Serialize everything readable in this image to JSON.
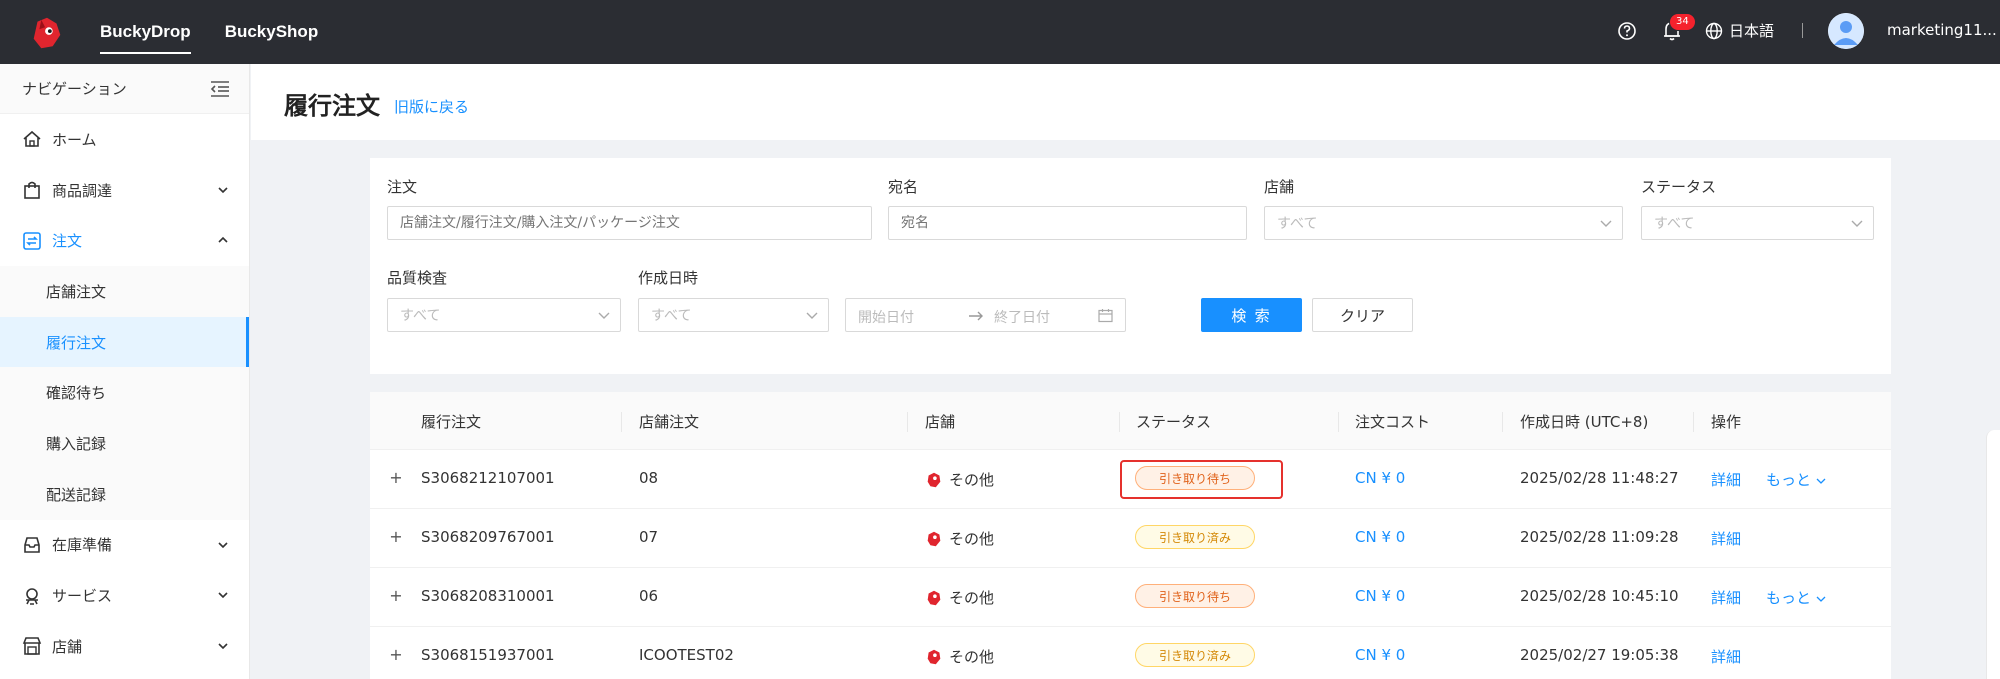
{
  "header": {
    "nav": [
      "BuckyDrop",
      "BuckyShop"
    ],
    "active_nav": "BuckyDrop",
    "notification_count": "34",
    "language": "日本語",
    "username": "marketing11..."
  },
  "sidebar": {
    "title": "ナビゲーション",
    "items": [
      {
        "label": "ホーム"
      },
      {
        "label": "商品調達"
      },
      {
        "label": "注文"
      },
      {
        "label": "在庫準備"
      },
      {
        "label": "サービス"
      },
      {
        "label": "店舗"
      }
    ],
    "order_sub": [
      {
        "label": "店舗注文"
      },
      {
        "label": "履行注文"
      },
      {
        "label": "確認待ち"
      },
      {
        "label": "購入記録"
      },
      {
        "label": "配送記録"
      }
    ]
  },
  "page": {
    "title": "履行注文",
    "back_link": "旧版に戻る"
  },
  "filters": {
    "order_label": "注文",
    "order_placeholder": "店舗注文/履行注文/購入注文/パッケージ注文",
    "recipient_label": "宛名",
    "recipient_placeholder": "宛名",
    "shop_label": "店舗",
    "shop_value": "すべて",
    "status_label": "ステータス",
    "status_value": "すべて",
    "qc_label": "品質検査",
    "qc_value": "すべて",
    "created_label": "作成日時",
    "created_value": "すべて",
    "start_date": "開始日付",
    "end_date": "終了日付",
    "search_btn": "検 索",
    "clear_btn": "クリア"
  },
  "table": {
    "columns": [
      "履行注文",
      "店舗注文",
      "店舗",
      "ステータス",
      "注文コスト",
      "作成日時 (UTC+8)",
      "操作"
    ],
    "rows": [
      {
        "id": "S3068212107001",
        "shop_order": "08",
        "shop": "その他",
        "status": "引き取り待ち",
        "status_type": "wait",
        "cost": "CN ¥ 0",
        "created": "2025/02/28 11:48:27",
        "detail": "詳細",
        "more": "もっと"
      },
      {
        "id": "S3068209767001",
        "shop_order": "07",
        "shop": "その他",
        "status": "引き取り済み",
        "status_type": "done",
        "cost": "CN ¥ 0",
        "created": "2025/02/28 11:09:28",
        "detail": "詳細",
        "more": ""
      },
      {
        "id": "S3068208310001",
        "shop_order": "06",
        "shop": "その他",
        "status": "引き取り待ち",
        "status_type": "wait",
        "cost": "CN ¥ 0",
        "created": "2025/02/28 10:45:10",
        "detail": "詳細",
        "more": "もっと"
      },
      {
        "id": "S3068151937001",
        "shop_order": "ICOOTEST02",
        "shop": "その他",
        "status": "引き取り済み",
        "status_type": "done",
        "cost": "CN ¥ 0",
        "created": "2025/02/27 19:05:38",
        "detail": "詳細",
        "more": ""
      }
    ]
  },
  "colors": {
    "topbar": "#2b2d33",
    "primary": "#1890ff",
    "highlight": "#e5312d"
  }
}
